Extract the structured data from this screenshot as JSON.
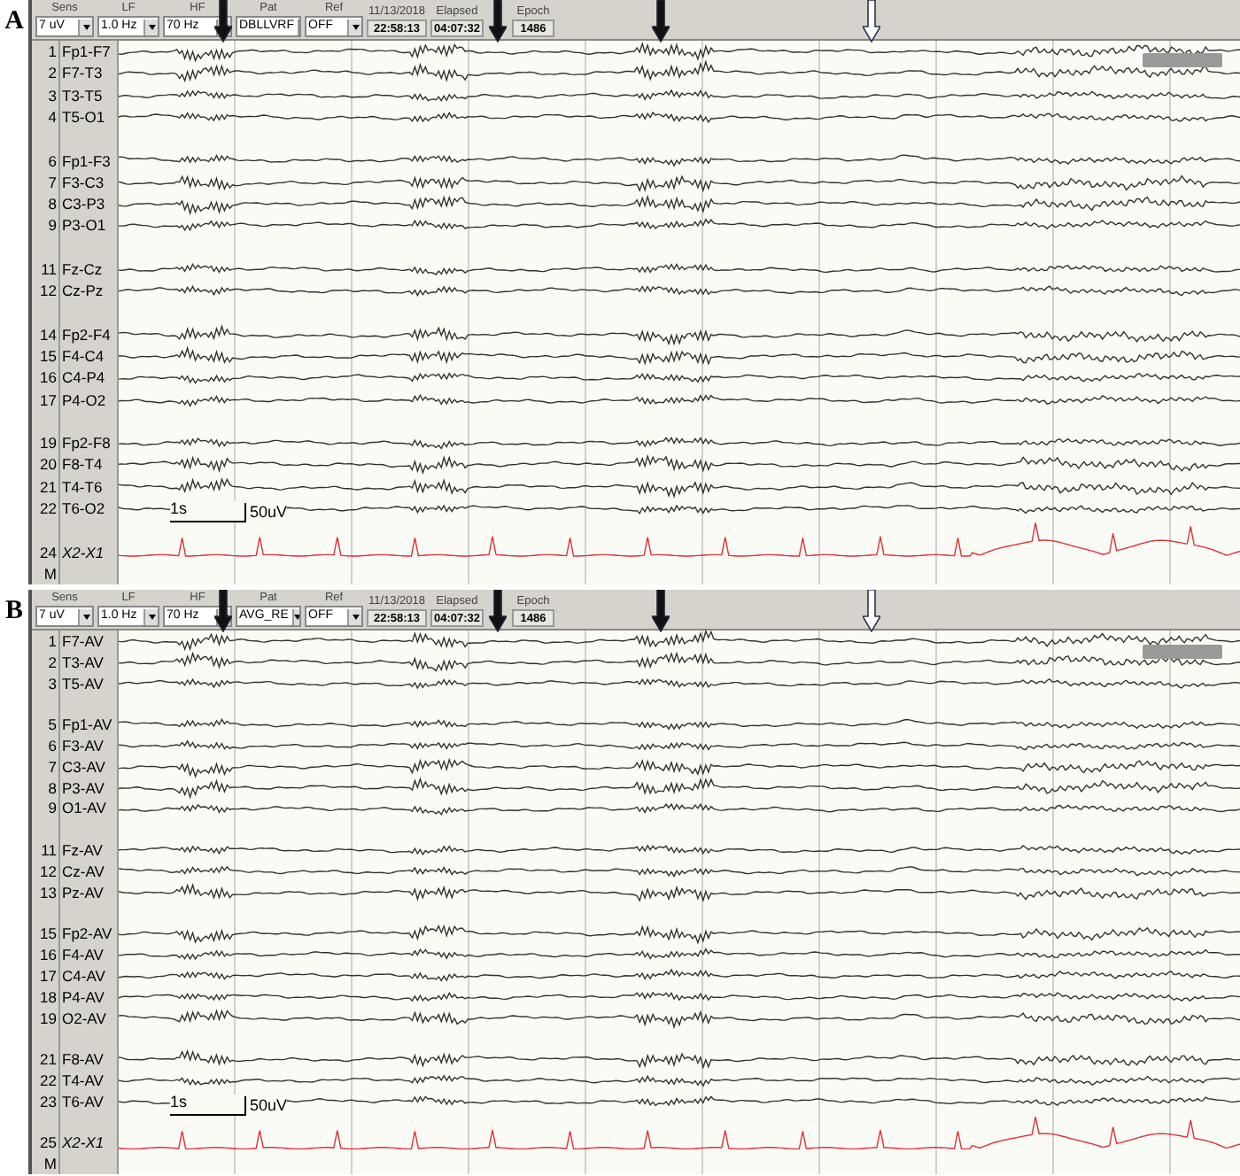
{
  "panels": [
    {
      "letter": "A",
      "toolbar": {
        "fields": [
          {
            "label": "Sens",
            "value": "7 uV"
          },
          {
            "label": "LF",
            "value": "1.0 Hz"
          },
          {
            "label": "HF",
            "value": "70 Hz"
          },
          {
            "label": "Pat",
            "value": "DBLLVRF"
          },
          {
            "label": "Ref",
            "value": "OFF"
          }
        ],
        "readouts": [
          {
            "label": "11/13/2018",
            "value": "22:58:13"
          },
          {
            "label": "Elapsed",
            "value": "04:07:32"
          },
          {
            "label": "Epoch",
            "value": "1486"
          }
        ]
      },
      "arrows": [
        {
          "kind": "filled"
        },
        {
          "kind": "filled"
        },
        {
          "kind": "filled"
        },
        {
          "kind": "open"
        }
      ],
      "groups": [
        [
          {
            "number": "1",
            "name": "Fp1-F7",
            "kind": "eeg"
          },
          {
            "number": "2",
            "name": "F7-T3",
            "kind": "eeg"
          },
          {
            "number": "3",
            "name": "T3-T5",
            "kind": "eeg"
          },
          {
            "number": "4",
            "name": "T5-O1",
            "kind": "eeg"
          }
        ],
        [
          {
            "number": "6",
            "name": "Fp1-F3",
            "kind": "eeg"
          },
          {
            "number": "7",
            "name": "F3-C3",
            "kind": "eeg"
          },
          {
            "number": "8",
            "name": "C3-P3",
            "kind": "eeg"
          },
          {
            "number": "9",
            "name": "P3-O1",
            "kind": "eeg"
          }
        ],
        [
          {
            "number": "11",
            "name": "Fz-Cz",
            "kind": "eeg"
          },
          {
            "number": "12",
            "name": "Cz-Pz",
            "kind": "eeg"
          }
        ],
        [
          {
            "number": "14",
            "name": "Fp2-F4",
            "kind": "eeg"
          },
          {
            "number": "15",
            "name": "F4-C4",
            "kind": "eeg"
          },
          {
            "number": "16",
            "name": "C4-P4",
            "kind": "eeg"
          },
          {
            "number": "17",
            "name": "P4-O2",
            "kind": "eeg"
          }
        ],
        [
          {
            "number": "19",
            "name": "Fp2-F8",
            "kind": "eeg"
          },
          {
            "number": "20",
            "name": "F8-T4",
            "kind": "eeg"
          },
          {
            "number": "21",
            "name": "T4-T6",
            "kind": "eeg"
          },
          {
            "number": "22",
            "name": "T6-O2",
            "kind": "eeg"
          }
        ],
        [
          {
            "number": "24",
            "name": "X2-X1",
            "kind": "ecg"
          }
        ]
      ],
      "marker_row": "M",
      "scale": {
        "time": "1s",
        "amplitude": "50uV"
      }
    },
    {
      "letter": "B",
      "toolbar": {
        "fields": [
          {
            "label": "Sens",
            "value": "7 uV"
          },
          {
            "label": "LF",
            "value": "1.0 Hz"
          },
          {
            "label": "HF",
            "value": "70 Hz"
          },
          {
            "label": "Pat",
            "value": "AVG_RE"
          },
          {
            "label": "Ref",
            "value": "OFF"
          }
        ],
        "readouts": [
          {
            "label": "11/13/2018",
            "value": "22:58:13"
          },
          {
            "label": "Elapsed",
            "value": "04:07:32"
          },
          {
            "label": "Epoch",
            "value": "1486"
          }
        ]
      },
      "arrows": [
        {
          "kind": "filled"
        },
        {
          "kind": "filled"
        },
        {
          "kind": "filled"
        },
        {
          "kind": "open"
        }
      ],
      "groups": [
        [
          {
            "number": "1",
            "name": "F7-AV",
            "kind": "eeg"
          },
          {
            "number": "2",
            "name": "T3-AV",
            "kind": "eeg"
          },
          {
            "number": "3",
            "name": "T5-AV",
            "kind": "eeg"
          }
        ],
        [
          {
            "number": "5",
            "name": "Fp1-AV",
            "kind": "eeg"
          },
          {
            "number": "6",
            "name": "F3-AV",
            "kind": "eeg"
          },
          {
            "number": "7",
            "name": "C3-AV",
            "kind": "eeg"
          },
          {
            "number": "8",
            "name": "P3-AV",
            "kind": "eeg"
          },
          {
            "number": "9",
            "name": "O1-AV",
            "kind": "eeg"
          }
        ],
        [
          {
            "number": "11",
            "name": "Fz-AV",
            "kind": "eeg"
          },
          {
            "number": "12",
            "name": "Cz-AV",
            "kind": "eeg"
          },
          {
            "number": "13",
            "name": "Pz-AV",
            "kind": "eeg"
          }
        ],
        [
          {
            "number": "15",
            "name": "Fp2-AV",
            "kind": "eeg"
          },
          {
            "number": "16",
            "name": "F4-AV",
            "kind": "eeg"
          },
          {
            "number": "17",
            "name": "C4-AV",
            "kind": "eeg"
          },
          {
            "number": "18",
            "name": "P4-AV",
            "kind": "eeg"
          },
          {
            "number": "19",
            "name": "O2-AV",
            "kind": "eeg"
          }
        ],
        [
          {
            "number": "21",
            "name": "F8-AV",
            "kind": "eeg"
          },
          {
            "number": "22",
            "name": "T4-AV",
            "kind": "eeg"
          },
          {
            "number": "23",
            "name": "T6-AV",
            "kind": "eeg"
          }
        ],
        [
          {
            "number": "25",
            "name": "X2-X1",
            "kind": "ecg"
          }
        ]
      ],
      "marker_row": "M",
      "scale": {
        "time": "1s",
        "amplitude": "50uV"
      }
    }
  ]
}
